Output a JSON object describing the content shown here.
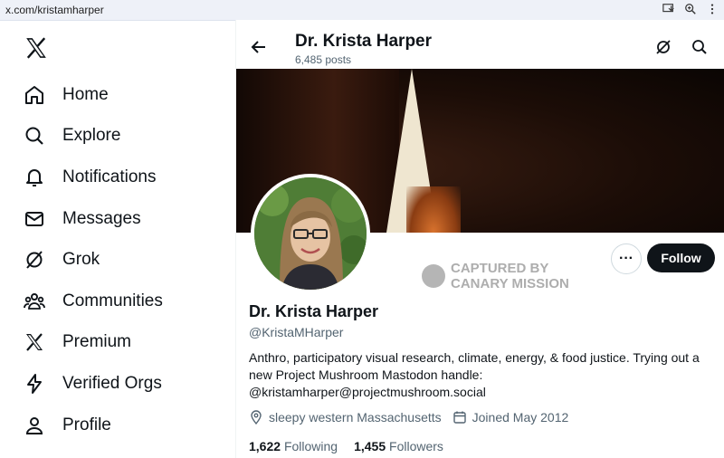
{
  "browser": {
    "url": "x.com/kristamharper"
  },
  "sidebar": {
    "items": [
      {
        "label": "Home"
      },
      {
        "label": "Explore"
      },
      {
        "label": "Notifications"
      },
      {
        "label": "Messages"
      },
      {
        "label": "Grok"
      },
      {
        "label": "Communities"
      },
      {
        "label": "Premium"
      },
      {
        "label": "Verified Orgs"
      },
      {
        "label": "Profile"
      }
    ]
  },
  "header": {
    "name": "Dr. Krista Harper",
    "posts": "6,485 posts"
  },
  "profile": {
    "name": "Dr. Krista Harper",
    "handle": "@KristaMHarper",
    "bio": "Anthro, participatory visual research, climate, energy, & food justice. Trying out a new Project Mushroom Mastodon handle: @kristamharper@projectmushroom.social",
    "location": "sleepy western Massachusetts",
    "joined": "Joined May 2012",
    "following_count": "1,622",
    "following_label": "Following",
    "followers_count": "1,455",
    "followers_label": "Followers",
    "follow_label": "Follow",
    "more_label": "···"
  },
  "watermark": {
    "line1": "CAPTURED BY",
    "line2": "CANARY MISSION"
  },
  "colors": {
    "text": "#0f1419",
    "muted": "#536471",
    "follow_bg": "#0f1419"
  }
}
